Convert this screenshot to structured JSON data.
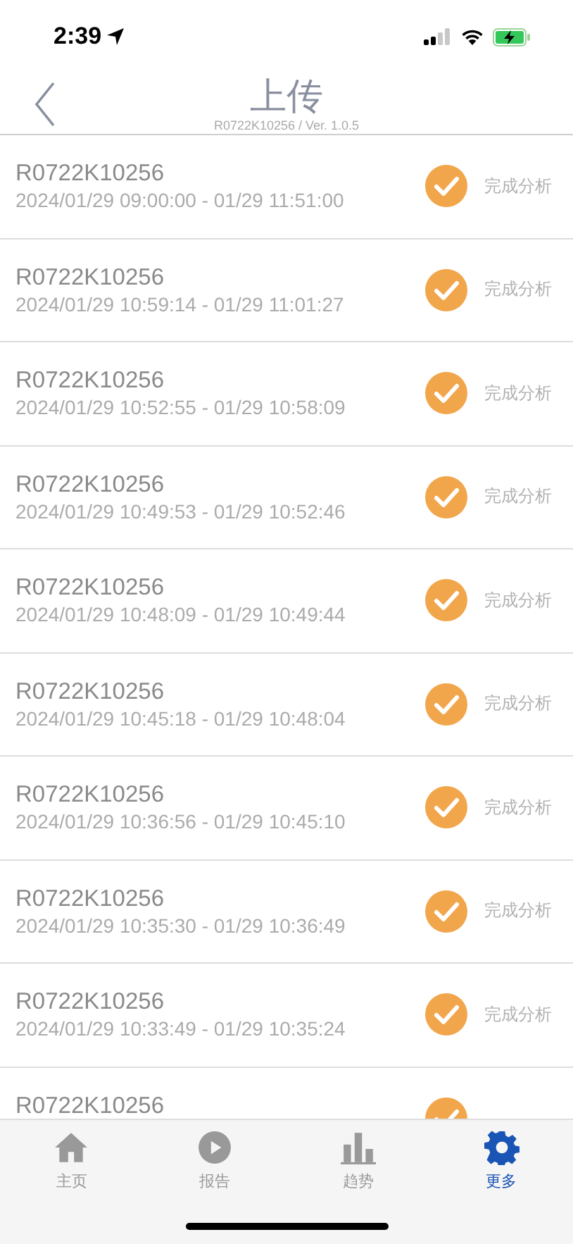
{
  "status_bar": {
    "time": "2:39"
  },
  "header": {
    "title": "上传",
    "subtitle": "R0722K10256 / Ver. 1.0.5"
  },
  "uploads": [
    {
      "device": "R0722K10256",
      "period": "2024/01/29 09:00:00 - 01/29 11:51:00",
      "done": true,
      "status": "完成分析"
    },
    {
      "device": "R0722K10256",
      "period": "2024/01/29 10:59:14 - 01/29 11:01:27",
      "done": true,
      "status": "完成分析"
    },
    {
      "device": "R0722K10256",
      "period": "2024/01/29 10:52:55 - 01/29 10:58:09",
      "done": true,
      "status": "完成分析"
    },
    {
      "device": "R0722K10256",
      "period": "2024/01/29 10:49:53 - 01/29 10:52:46",
      "done": true,
      "status": "完成分析"
    },
    {
      "device": "R0722K10256",
      "period": "2024/01/29 10:48:09 - 01/29 10:49:44",
      "done": true,
      "status": "完成分析"
    },
    {
      "device": "R0722K10256",
      "period": "2024/01/29 10:45:18 - 01/29 10:48:04",
      "done": true,
      "status": "完成分析"
    },
    {
      "device": "R0722K10256",
      "period": "2024/01/29 10:36:56 - 01/29 10:45:10",
      "done": true,
      "status": "完成分析"
    },
    {
      "device": "R0722K10256",
      "period": "2024/01/29 10:35:30 - 01/29 10:36:49",
      "done": true,
      "status": "完成分析"
    },
    {
      "device": "R0722K10256",
      "period": "2024/01/29 10:33:49 - 01/29 10:35:24",
      "done": true,
      "status": "完成分析"
    },
    {
      "device": "R0722K10256",
      "done": true
    }
  ],
  "tabs": [
    {
      "label": "主页",
      "selected": false
    },
    {
      "label": "报告",
      "selected": false
    },
    {
      "label": "趋势",
      "selected": false
    },
    {
      "label": "更多",
      "selected": true
    }
  ]
}
